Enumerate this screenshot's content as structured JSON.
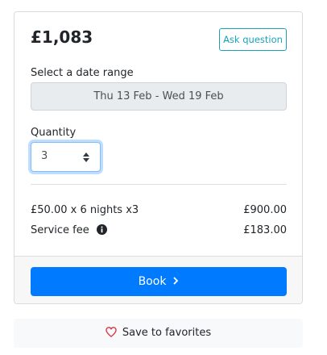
{
  "booking": {
    "price": "£1,083",
    "ask_question_label": "Ask question",
    "date_range_label": "Select a date range",
    "date_range_value": "Thu 13 Feb - Wed 19 Feb",
    "quantity_label": "Quantity",
    "quantity_value": "3",
    "lines": [
      {
        "label": "£50.00 x 6 nights x3",
        "amount": "£900.00"
      },
      {
        "label": "Service fee",
        "amount": "£183.00"
      }
    ],
    "book_label": "Book",
    "favorites_label": "Save to favorites"
  },
  "colors": {
    "primary": "#007bff",
    "info": "#17a2b8",
    "heart": "#dc3545"
  },
  "icons": {
    "info": "info-circle-icon",
    "sort": "sort-arrows-icon",
    "chevron": "chevron-right-icon",
    "heart": "heart-outline-icon"
  }
}
